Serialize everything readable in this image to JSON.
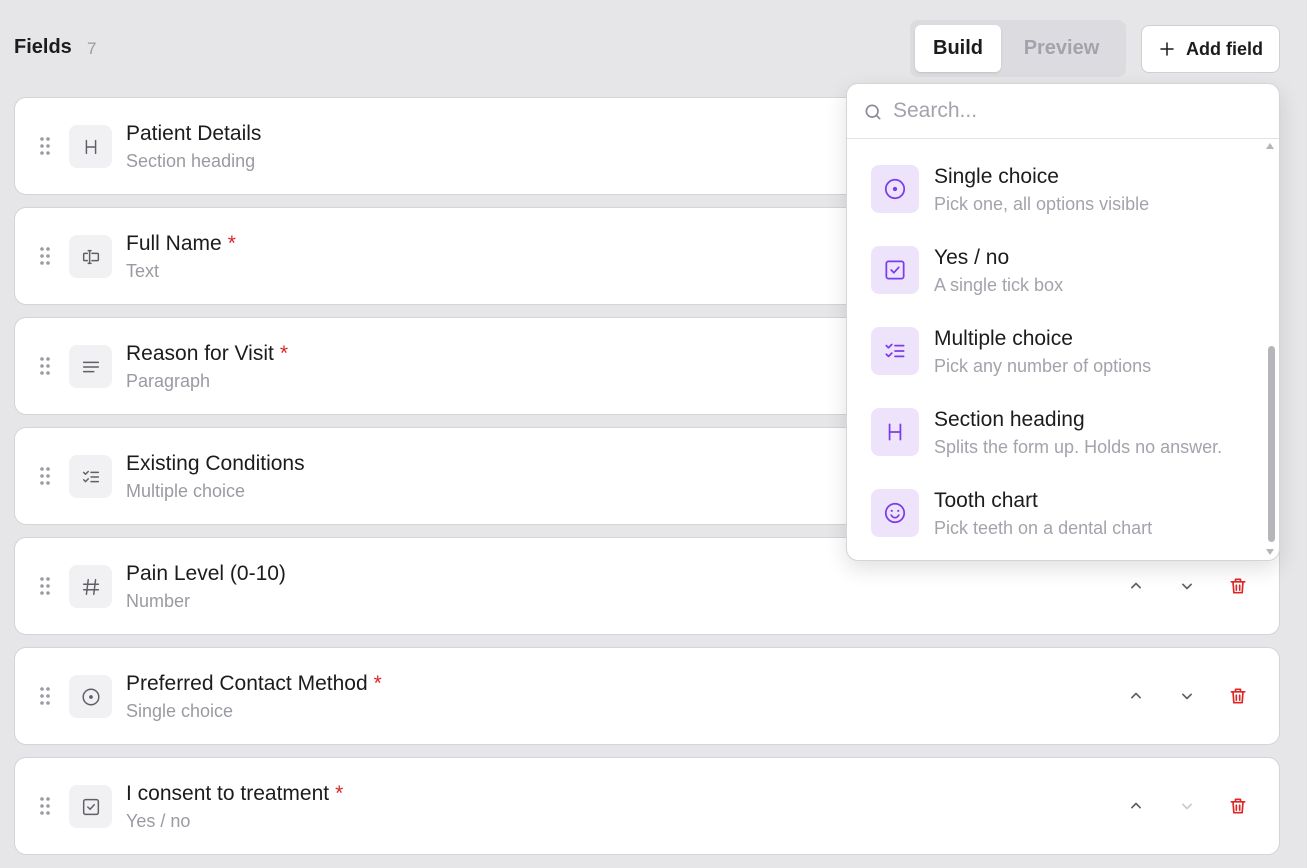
{
  "header": {
    "title": "Fields",
    "count": "7",
    "mode_build": "Build",
    "mode_preview": "Preview",
    "add_field": "Add field"
  },
  "fields": [
    {
      "label": "Patient Details",
      "type": "Section heading",
      "required": false,
      "icon": "heading-icon"
    },
    {
      "label": "Full Name",
      "type": "Text",
      "required": true,
      "icon": "text-cursor-icon"
    },
    {
      "label": "Reason for Visit",
      "type": "Paragraph",
      "required": true,
      "icon": "paragraph-icon"
    },
    {
      "label": "Existing Conditions",
      "type": "Multiple choice",
      "required": false,
      "icon": "checklist-icon"
    },
    {
      "label": "Pain Level (0-10)",
      "type": "Number",
      "required": false,
      "icon": "hash-icon"
    },
    {
      "label": "Preferred Contact Method",
      "type": "Single choice",
      "required": true,
      "icon": "radio-icon"
    },
    {
      "label": "I consent to treatment",
      "type": "Yes / no",
      "required": true,
      "icon": "checkbox-icon"
    }
  ],
  "required_marker": "*",
  "dropdown": {
    "search_placeholder": "Search...",
    "options": [
      {
        "label": "Single choice",
        "desc": "Pick one, all options visible",
        "icon": "radio-icon"
      },
      {
        "label": "Yes / no",
        "desc": "A single tick box",
        "icon": "checkbox-icon"
      },
      {
        "label": "Multiple choice",
        "desc": "Pick any number of options",
        "icon": "checklist-icon"
      },
      {
        "label": "Section heading",
        "desc": "Splits the form up. Holds no answer.",
        "icon": "heading-icon"
      },
      {
        "label": "Tooth chart",
        "desc": "Pick teeth on a dental chart",
        "icon": "smiley-icon"
      }
    ]
  },
  "colors": {
    "accent": "#7c3aed",
    "accent_bg": "#ede4fb",
    "danger": "#dc2626",
    "muted": "#9a9aa2"
  }
}
